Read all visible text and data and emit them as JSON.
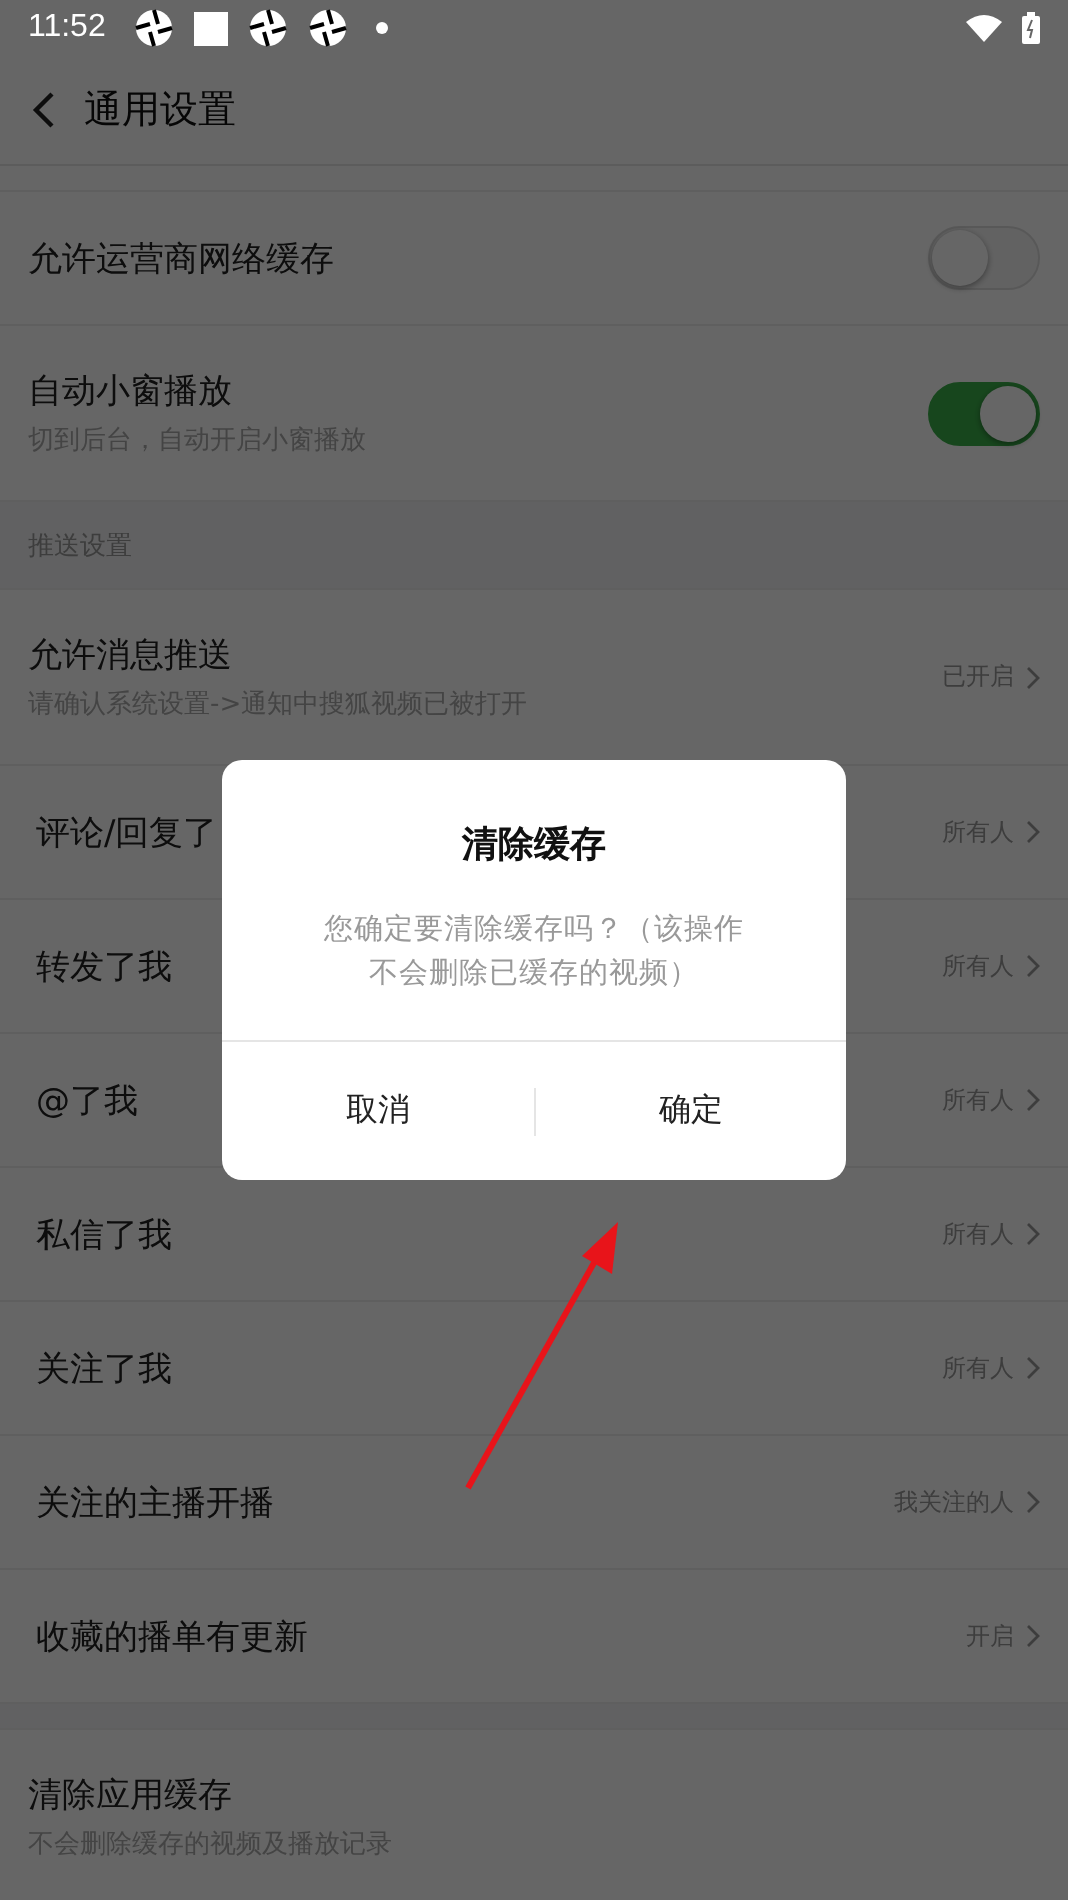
{
  "status_bar": {
    "time": "11:52"
  },
  "header": {
    "title": "通用设置"
  },
  "rows": [
    {
      "kind": "toggle",
      "label": "允许运营商网络缓存",
      "on": false
    },
    {
      "kind": "toggle",
      "label": "自动小窗播放",
      "subtitle": "切到后台，自动开启小窗播放",
      "on": true
    },
    {
      "kind": "section",
      "label": "推送设置"
    },
    {
      "kind": "link",
      "label": "允许消息推送",
      "subtitle": "请确认系统设置->通知中搜狐视频已被打开",
      "value": "已开启"
    },
    {
      "kind": "link",
      "label": "评论/回复了",
      "value": "所有人"
    },
    {
      "kind": "link",
      "label": "转发了我",
      "value": "所有人"
    },
    {
      "kind": "link",
      "label": "@了我",
      "value": "所有人"
    },
    {
      "kind": "link",
      "label": "私信了我",
      "value": "所有人"
    },
    {
      "kind": "link",
      "label": "关注了我",
      "value": "所有人"
    },
    {
      "kind": "link",
      "label": "关注的主播开播",
      "value": "我关注的人"
    },
    {
      "kind": "link",
      "label": "收藏的播单有更新",
      "value": "开启"
    },
    {
      "kind": "action",
      "label": "清除应用缓存",
      "subtitle": "不会删除缓存的视频及播放记录"
    }
  ],
  "dialog": {
    "title": "清除缓存",
    "message": "您确定要清除缓存吗？（该操作不会删除已缓存的视频）",
    "buttons": [
      "取消",
      "确定"
    ]
  }
}
